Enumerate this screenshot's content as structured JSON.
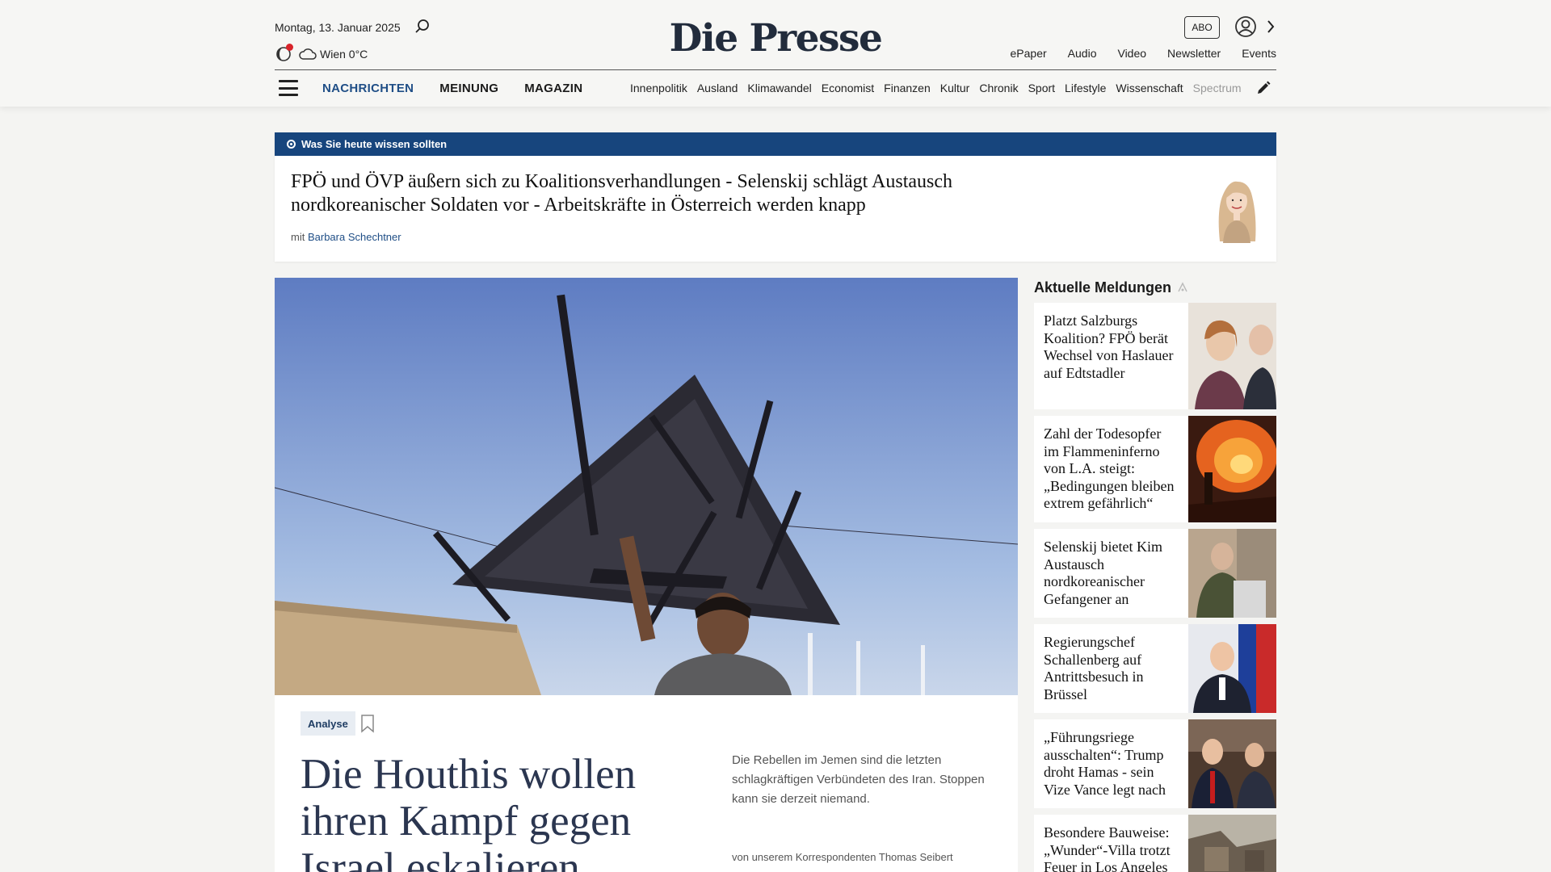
{
  "header": {
    "date": "Montag, 13. Januar 2025",
    "weather": "Wien 0°C",
    "logo": "Die Presse",
    "abo": "ABO",
    "links": [
      "ePaper",
      "Audio",
      "Video",
      "Newsletter",
      "Events"
    ],
    "main_nav": [
      "NACHRICHTEN",
      "MEINUNG",
      "MAGAZIN"
    ],
    "sub_nav": [
      "Innenpolitik",
      "Ausland",
      "Klimawandel",
      "Economist",
      "Finanzen",
      "Kultur",
      "Chronik",
      "Sport",
      "Lifestyle",
      "Wissenschaft",
      "Spectrum"
    ],
    "accent_color": "#1f4e86"
  },
  "briefing": {
    "label": "Was Sie heute wissen sollten",
    "title": "FPÖ und ÖVP äußern sich zu Koalitionsverhandlungen - Selenskij schlägt Austausch nordkoreanischer Soldaten vor - Arbeitskräfte in Österreich werden knapp",
    "by_prefix": "mit",
    "author": "Barbara Schechtner",
    "bar_color": "#17457d"
  },
  "hero": {
    "tag": "Analyse",
    "title": "Die Houthis wollen ihren Kampf gegen Israel eskalieren",
    "teaser": "Die Rebellen im Jemen sind die letzten schlagkräftigen Verbündeten des Iran. Stoppen kann sie derzeit niemand.",
    "author": "von unserem Korrespondenten Thomas Seibert"
  },
  "sidebar": {
    "heading": "Aktuelle Meldungen",
    "items": [
      {
        "title": "Platzt Salzburgs Koalition? FPÖ berät Wechsel von Haslauer auf Edtstadler"
      },
      {
        "title": "Zahl der Todesopfer im Flammeninferno von L.A. steigt: „Bedingungen bleiben extrem gefährlich“"
      },
      {
        "title": "Selenskij bietet Kim Austausch nordkoreanischer Gefangener an"
      },
      {
        "title": "Regierungschef Schallenberg auf Antrittsbesuch in Brüssel"
      },
      {
        "title": "„Führungsriege ausschalten“: Trump droht Hamas - sein Vize Vance legt nach"
      },
      {
        "title": "Besondere Bauweise: „Wunder“-Villa trotzt Feuer in Los Angeles"
      }
    ]
  }
}
